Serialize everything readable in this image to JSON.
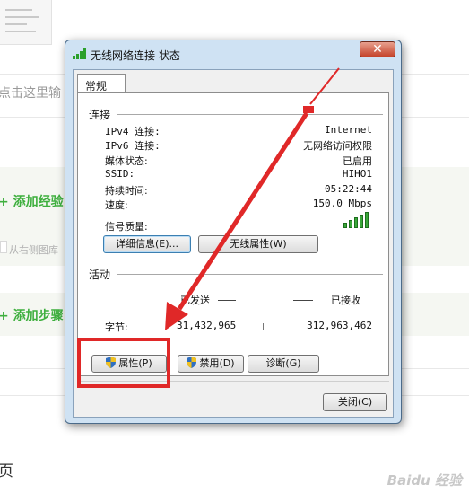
{
  "background": {
    "hint_text": "点击这里输",
    "add_experience": "添加经验",
    "image_hint": "从右侧图库",
    "add_step": "添加步骤",
    "page_char": "页",
    "watermark": "Baidu 经验"
  },
  "window": {
    "title": "无线网络连接 状态",
    "close_symbol": "✕",
    "tab": "常规",
    "connection": {
      "section_title": "连接",
      "rows": [
        {
          "label": "IPv4 连接:",
          "value": "Internet"
        },
        {
          "label": "IPv6 连接:",
          "value": "无网络访问权限"
        },
        {
          "label": "媒体状态:",
          "value": "已启用"
        },
        {
          "label": "SSID:",
          "value": "HIHO1"
        },
        {
          "label": "持续时间:",
          "value": "05:22:44"
        },
        {
          "label": "速度:",
          "value": "150.0 Mbps"
        }
      ],
      "signal_label": "信号质量:",
      "signal_bars": 5,
      "details_button": "详细信息(E)...",
      "wireless_props_button": "无线属性(W)"
    },
    "activity": {
      "section_title": "活动",
      "sent_label": "已发送",
      "received_label": "已接收",
      "bytes_label": "字节:",
      "bytes_sent": "31,432,965",
      "bytes_received": "312,963,462"
    },
    "buttons": {
      "properties": "属性(P)",
      "disable": "禁用(D)",
      "diagnose": "诊断(G)",
      "close": "关闭(C)"
    }
  },
  "colors": {
    "annotation_red": "#e02828",
    "accent_green": "#3eaf3e"
  }
}
